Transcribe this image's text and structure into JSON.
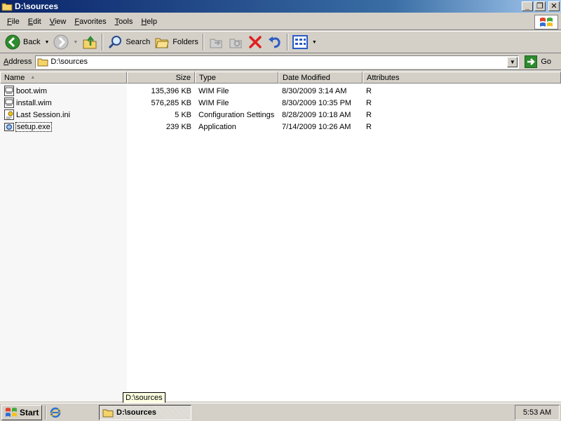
{
  "window": {
    "title": "D:\\sources",
    "buttons": {
      "minimize": "_",
      "maximize": "❐",
      "close": "✕"
    }
  },
  "menu": [
    "File",
    "Edit",
    "View",
    "Favorites",
    "Tools",
    "Help"
  ],
  "toolbar": {
    "back_label": "Back",
    "search_label": "Search",
    "folders_label": "Folders"
  },
  "address": {
    "label": "Address",
    "value": "D:\\sources",
    "go_label": "Go"
  },
  "columns": [
    "Name",
    "Size",
    "Type",
    "Date Modified",
    "Attributes"
  ],
  "files": [
    {
      "name": "boot.wim",
      "size": "135,396 KB",
      "type": "WIM File",
      "date": "8/30/2009 3:14 AM",
      "attr": "R",
      "icon": "wim-file-icon"
    },
    {
      "name": "install.wim",
      "size": "576,285 KB",
      "type": "WIM File",
      "date": "8/30/2009 10:35 PM",
      "attr": "R",
      "icon": "wim-file-icon"
    },
    {
      "name": "Last Session.ini",
      "size": "5 KB",
      "type": "Configuration Settings",
      "date": "8/28/2009 10:18 AM",
      "attr": "R",
      "icon": "ini-file-icon"
    },
    {
      "name": "setup.exe",
      "size": "239 KB",
      "type": "Application",
      "date": "7/14/2009 10:26 AM",
      "attr": "R",
      "icon": "setup-exe-icon"
    }
  ],
  "tooltip": "D:\\sources",
  "taskbar": {
    "start_label": "Start",
    "task_label": "D:\\sources",
    "clock": "5:53 AM"
  },
  "colors": {
    "titlebar_start": "#0a246a",
    "titlebar_end": "#a6caf0",
    "face": "#d4d0c8",
    "delete_red": "#e02020",
    "go_green": "#2e8b2e",
    "folder_yellow": "#f4d36b"
  }
}
